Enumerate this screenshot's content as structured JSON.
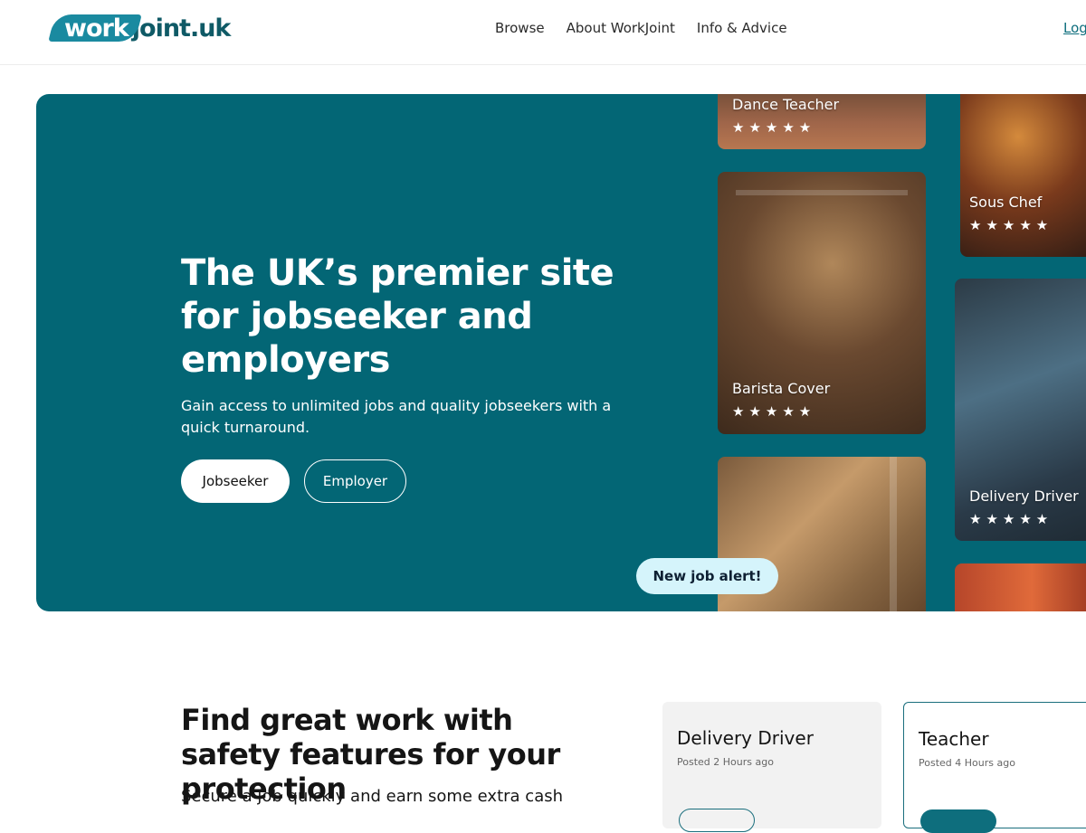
{
  "header": {
    "logo_work": "work",
    "logo_rest": "joint.uk",
    "nav": [
      "Browse",
      "About WorkJoint",
      "Info & Advice"
    ],
    "login": "Log"
  },
  "hero": {
    "title": "The UK’s premier site for jobseeker and employers",
    "subtitle": "Gain access to unlimited jobs and quality jobseekers with a quick turnaround.",
    "btn_jobseeker": "Jobseeker",
    "btn_employer": "Employer",
    "alert": "New job alert!",
    "cards": [
      {
        "label": "Dance Teacher",
        "stars": "★★★★★"
      },
      {
        "label": "Barista Cover",
        "stars": "★★★★★"
      },
      {
        "label": "Sous Chef",
        "stars": "★★★★★"
      },
      {
        "label": "Delivery Driver",
        "stars": "★★★★★"
      }
    ]
  },
  "section": {
    "title": "Find great work with safety features for your protection",
    "subtitle": "Secure a job quickly and earn some extra cash"
  },
  "jobs": [
    {
      "title": "Delivery Driver",
      "posted": "Posted 2 Hours ago"
    },
    {
      "title": "Teacher",
      "posted": "Posted 4 Hours ago"
    }
  ],
  "colors": {
    "brand": "#036675",
    "accent": "#1a8aa0",
    "alert_bg": "#d5f4fb"
  }
}
